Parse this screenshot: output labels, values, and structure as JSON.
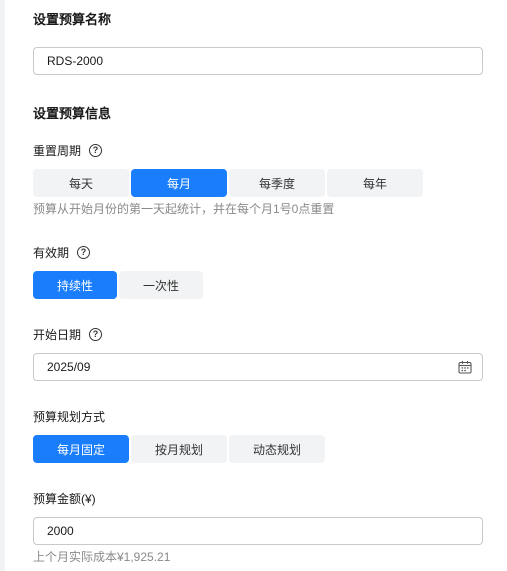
{
  "budget_name": {
    "title": "设置预算名称",
    "value": "RDS-2000"
  },
  "budget_info": {
    "title": "设置预算信息",
    "reset_cycle": {
      "label": "重置周期",
      "options": [
        "每天",
        "每月",
        "每季度",
        "每年"
      ],
      "selected": "每月",
      "hint": "预算从开始月份的第一天起统计，并在每个月1号0点重置"
    },
    "validity": {
      "label": "有效期",
      "options": [
        "持续性",
        "一次性"
      ],
      "selected": "持续性"
    },
    "start_date": {
      "label": "开始日期",
      "value": "2025/09"
    },
    "planning_mode": {
      "label": "预算规划方式",
      "options": [
        "每月固定",
        "按月规划",
        "动态规划"
      ],
      "selected": "每月固定"
    },
    "amount": {
      "label": "预算金额(¥)",
      "value": "2000",
      "hint": "上个月实际成本¥1,925.21"
    }
  },
  "icons": {
    "help": "question-circle-icon",
    "calendar": "calendar-icon"
  },
  "colors": {
    "accent": "#1a7dfc",
    "segment_bg": "#f2f3f5",
    "hint": "#8a8a8a",
    "border": "#c9c9c9"
  }
}
